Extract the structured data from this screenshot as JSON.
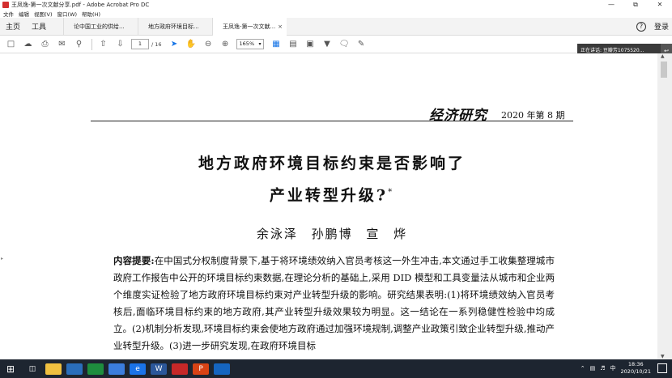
{
  "window": {
    "title": "王凤逸-第一次文献分享.pdf - Adobe Acrobat Pro DC",
    "controls": [
      "—",
      "⧉",
      "✕"
    ]
  },
  "menu": [
    "文件",
    "编辑",
    "视图(V)",
    "窗口(W)",
    "帮助(H)"
  ],
  "tabs": {
    "home": "主页",
    "tools": "工具",
    "docs": [
      {
        "label": "论中国工业的供给...",
        "active": false
      },
      {
        "label": "地方政府环境目标...",
        "active": false
      },
      {
        "label": "王凤逸-第一次文献...",
        "active": true
      }
    ],
    "close": "×",
    "login": "登录"
  },
  "toolbar": {
    "page_current": "1",
    "page_total": "/ 16",
    "zoom": "165%"
  },
  "notification": {
    "text": "正在讲话: 豆瓣芳1075520..."
  },
  "document": {
    "journal_logo": "经济研究",
    "journal_issue": "2020 年第 8 期",
    "title_line1": "地方政府环境目标约束是否影响了",
    "title_line2": "产业转型升级?",
    "title_star": "*",
    "authors": "余泳泽  孙鹏博  宣  烨",
    "abstract_label": "内容提要:",
    "abstract_text": "在中国式分权制度背景下,基于将环境绩效纳入官员考核这一外生冲击,本文通过手工收集整理城市政府工作报告中公开的环境目标约束数据,在理论分析的基础上,采用 DID 模型和工具变量法从城市和企业两个维度实证检验了地方政府环境目标约束对产业转型升级的影响。研究结果表明:(1)将环境绩效纳入官员考核后,面临环境目标约束的地方政府,其产业转型升级效果较为明显。这一结论在一系列稳健性检验中均成立。(2)机制分析发现,环境目标约束会使地方政府通过加强环境规制,调整产业政策引致企业转型升级,推动产业转型升级。(3)进一步研究发现,在政府环境目标"
  },
  "taskbar": {
    "tray_lang": "中",
    "time": "18:36",
    "date": "2020/10/21"
  }
}
